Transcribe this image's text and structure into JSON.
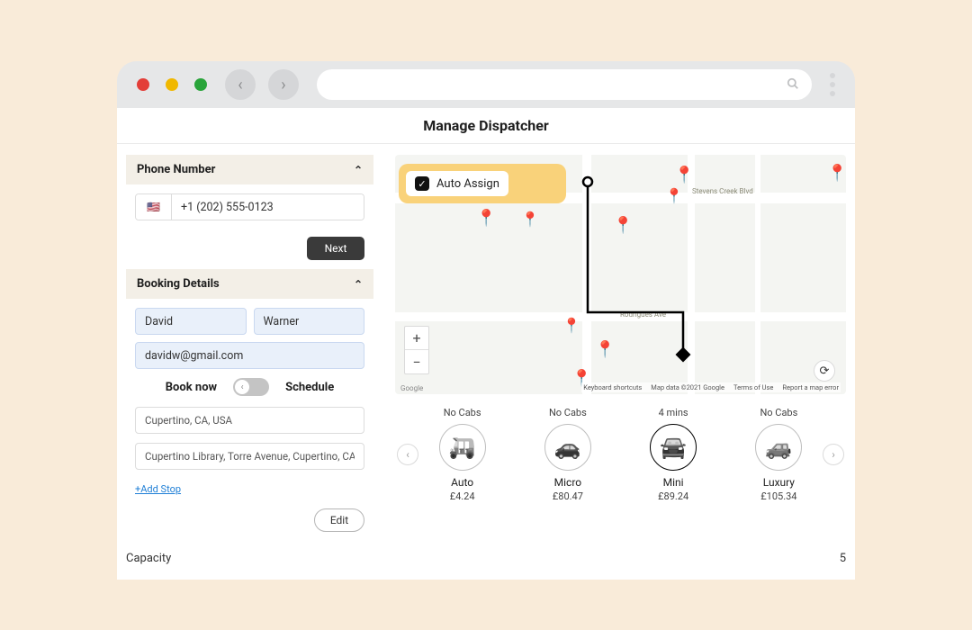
{
  "header": {
    "page_title": "Manage Dispatcher"
  },
  "phone": {
    "section_label": "Phone Number",
    "flag": "🇺🇸",
    "placeholder": "+1 (202) 555-0123",
    "value": "+1 (202) 555-0123",
    "next_label": "Next"
  },
  "booking": {
    "section_label": "Booking Details",
    "first_name": "David",
    "last_name": "Warner",
    "email": "davidw@gmail.com",
    "book_now_label": "Book now",
    "schedule_label": "Schedule",
    "pickup": "Cupertino, CA, USA",
    "dropoff": "Cupertino Library, Torre Avenue, Cupertino, CA, USA",
    "add_stop_label": "+Add Stop",
    "edit_label": "Edit"
  },
  "map": {
    "auto_assign_label": "Auto Assign",
    "attribution": {
      "shortcuts": "Keyboard shortcuts",
      "mapdata": "Map data ©2021 Google",
      "terms": "Terms of Use",
      "report": "Report a map error"
    },
    "logo": "Google",
    "streets": {
      "a": "Stevens Creek Blvd",
      "b": "Rodrigues Ave"
    }
  },
  "cabs": {
    "items": [
      {
        "wait": "No Cabs",
        "name": "Auto",
        "price": "£4.24",
        "icon": "🛺",
        "selected": false
      },
      {
        "wait": "No Cabs",
        "name": "Micro",
        "price": "£80.47",
        "icon": "🚗",
        "selected": false
      },
      {
        "wait": "4 mins",
        "name": "Mini",
        "price": "£89.24",
        "icon": "🚘",
        "selected": true
      },
      {
        "wait": "No Cabs",
        "name": "Luxury",
        "price": "£105.34",
        "icon": "🚙",
        "selected": false
      }
    ]
  },
  "capacity": {
    "label": "Capacity",
    "value": "5"
  }
}
